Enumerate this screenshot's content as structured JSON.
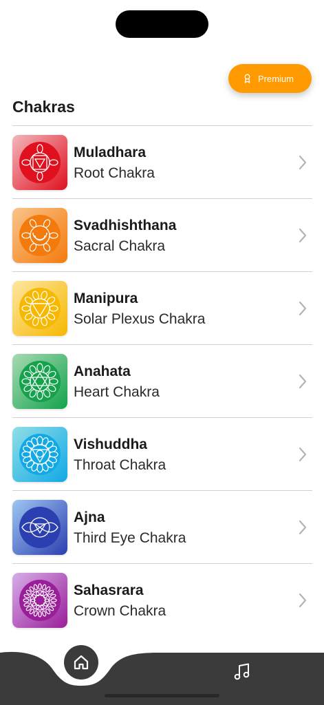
{
  "header": {
    "premium_label": "Premium",
    "title": "Chakras"
  },
  "chakras": [
    {
      "name": "Muladhara",
      "subtitle": "Root Chakra",
      "color": "#e0101e",
      "light": "#f2b7bd",
      "icon": "muladhara-symbol-icon"
    },
    {
      "name": "Svadhishthana",
      "subtitle": "Sacral Chakra",
      "color": "#f47a0c",
      "light": "#f9c48a",
      "icon": "svadhishthana-symbol-icon"
    },
    {
      "name": "Manipura",
      "subtitle": "Solar Plexus Chakra",
      "color": "#f6b800",
      "light": "#fde6a0",
      "icon": "manipura-symbol-icon"
    },
    {
      "name": "Anahata",
      "subtitle": "Heart Chakra",
      "color": "#14a34c",
      "light": "#a8d9b4",
      "icon": "anahata-symbol-icon"
    },
    {
      "name": "Vishuddha",
      "subtitle": "Throat Chakra",
      "color": "#11a8e6",
      "light": "#8fdfe6",
      "icon": "vishuddha-symbol-icon"
    },
    {
      "name": "Ajna",
      "subtitle": "Third Eye Chakra",
      "color": "#2c3fb0",
      "light": "#9ec6f2",
      "icon": "ajna-symbol-icon"
    },
    {
      "name": "Sahasrara",
      "subtitle": "Crown Chakra",
      "color": "#9a1e9a",
      "light": "#d6aee8",
      "icon": "sahasrara-symbol-icon"
    }
  ],
  "nav": {
    "items": [
      {
        "icon": "home-icon",
        "active": true
      },
      {
        "icon": "music-note-icon",
        "active": false
      }
    ],
    "background": "#3b3b3b"
  },
  "accent": "#ff9a00"
}
